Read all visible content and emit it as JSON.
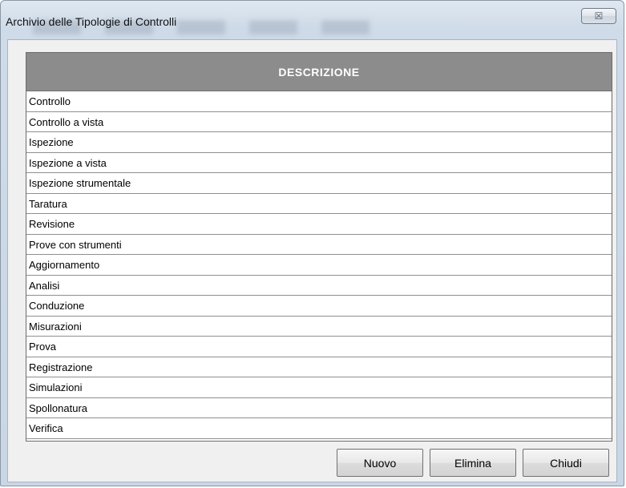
{
  "window": {
    "title": "Archivio delle Tipologie di Controlli",
    "close_glyph": "☒"
  },
  "grid": {
    "column_header": "DESCRIZIONE",
    "rows": [
      "Controllo",
      "Controllo a vista",
      "Ispezione",
      "Ispezione a vista",
      "Ispezione strumentale",
      "Taratura",
      "Revisione",
      "Prove con strumenti",
      "Aggiornamento",
      "Analisi",
      "Conduzione",
      "Misurazioni",
      "Prova",
      "Registrazione",
      "Simulazioni",
      "Spollonatura",
      "Verifica"
    ]
  },
  "buttons": {
    "new_label": "Nuovo",
    "delete_label": "Elimina",
    "close_label": "Chiudi"
  }
}
